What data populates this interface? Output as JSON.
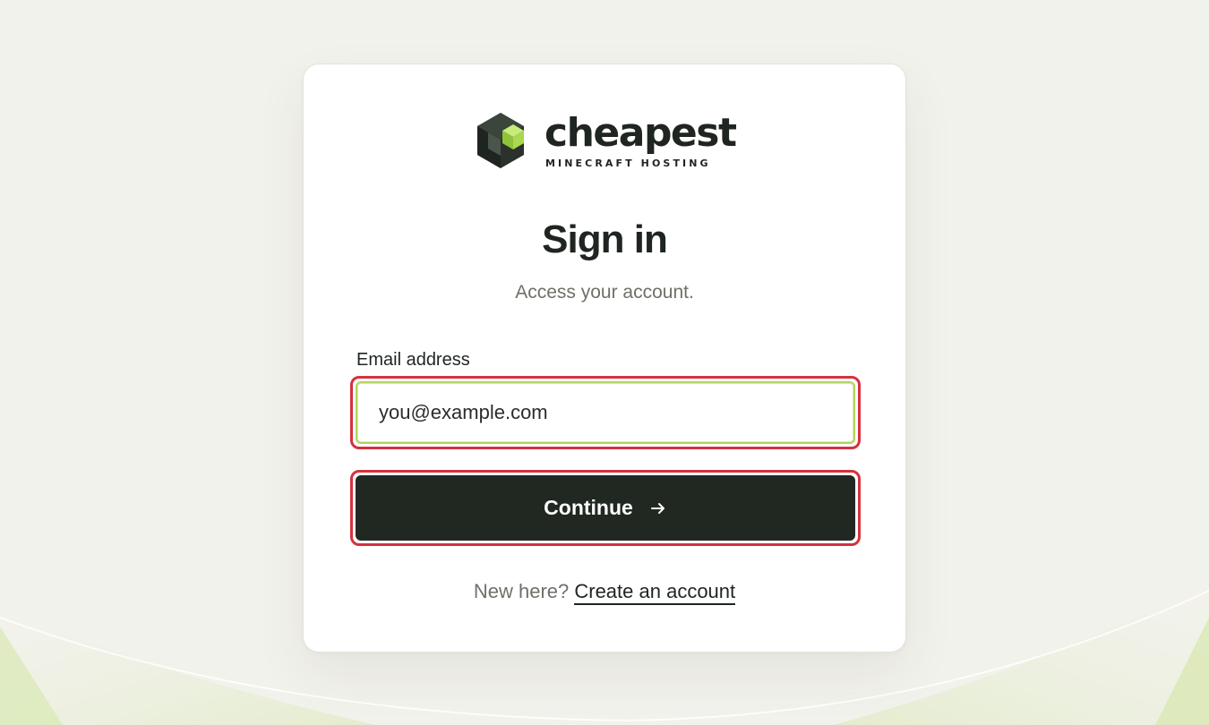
{
  "brand": {
    "wordmark": "cheapest",
    "tagline": "MINECRAFT HOSTING",
    "logo_icon": "cube-logo-icon",
    "accent_color": "#9ed243",
    "dark_color": "#212822"
  },
  "page": {
    "title": "Sign in",
    "subtitle": "Access your account."
  },
  "form": {
    "email_label": "Email address",
    "email_placeholder": "you@example.com",
    "email_value": "",
    "continue_label": "Continue",
    "continue_icon": "arrow-right-icon"
  },
  "footer": {
    "prompt": "New here?",
    "link_label": "Create an account"
  },
  "highlight_color": "#d4313e"
}
